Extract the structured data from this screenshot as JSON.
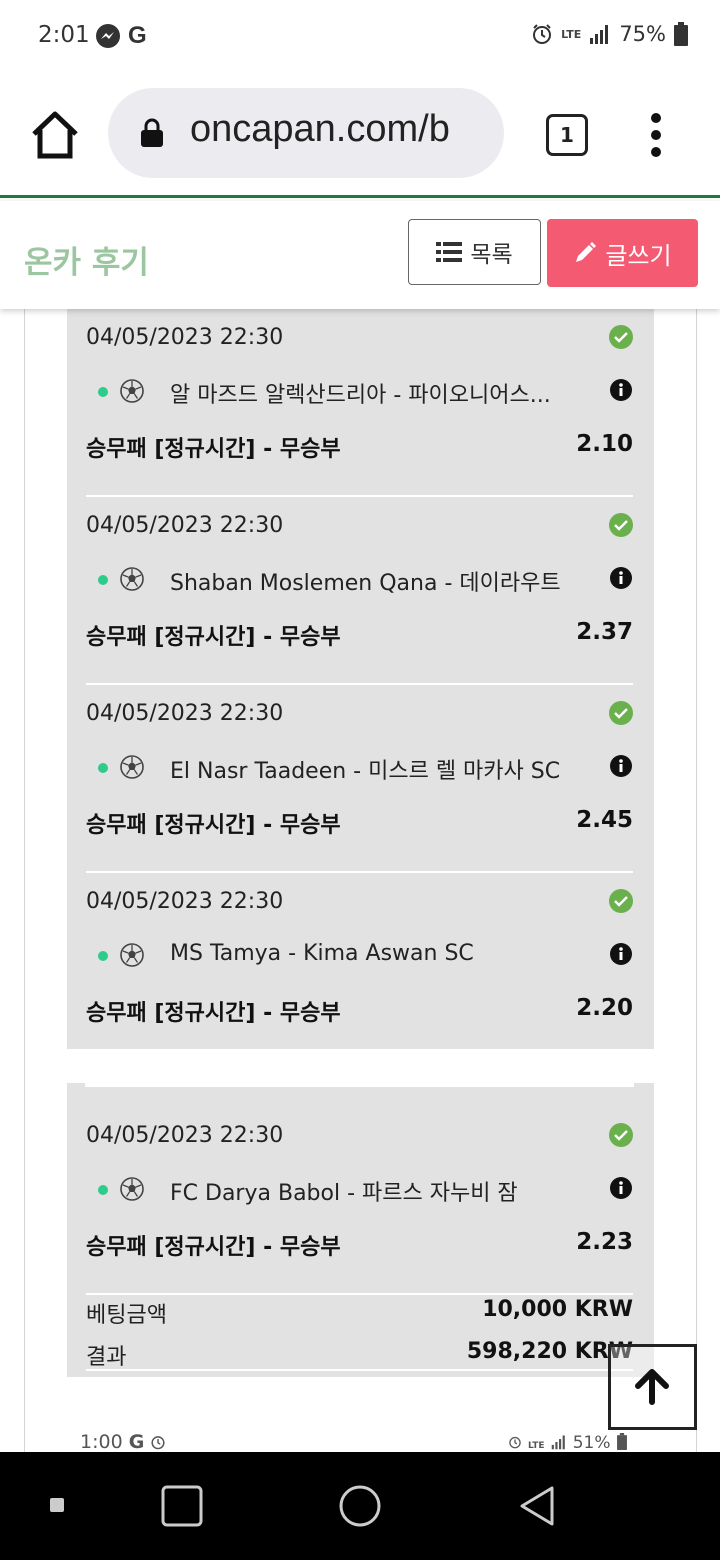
{
  "status_bar": {
    "time": "2:01",
    "carrier_glyph": "G",
    "network": "LTE",
    "battery": "75%",
    "icons": [
      "messenger-icon",
      "google-icon",
      "alarm-icon",
      "signal-icon",
      "battery-icon"
    ]
  },
  "browser": {
    "url": "oncapan.com/b",
    "tab_count": "1",
    "icons": [
      "home-icon",
      "lock-icon",
      "tabs-icon",
      "overflow-menu-icon"
    ]
  },
  "header": {
    "title": "온카 후기",
    "list_button": "목록",
    "write_button": "글쓰기",
    "colors": {
      "title": "#9cc6a0",
      "write_bg": "#f45b72"
    }
  },
  "bets": [
    {
      "date": "04/05/2023 22:30",
      "match": "알 마즈드 알렉산드리아 - 파이오니어스...",
      "market": "승무패 [정규시간] - 무승부",
      "odds": "2.10"
    },
    {
      "date": "04/05/2023 22:30",
      "match": "Shaban Moslemen Qana - 데이라우트",
      "market": "승무패 [정규시간] - 무승부",
      "odds": "2.37"
    },
    {
      "date": "04/05/2023 22:30",
      "match": "El Nasr Taadeen - 미스르 렐 마카사 SC",
      "market": "승무패 [정규시간] - 무승부",
      "odds": "2.45"
    },
    {
      "date": "04/05/2023 22:30",
      "match": "MS Tamya - Kima Aswan SC",
      "market": "승무패 [정규시간] - 무승부",
      "odds": "2.20"
    },
    {
      "date": "04/05/2023 22:30",
      "match": "FC Darya Babol - 파르스 자누비 잠",
      "market": "승무패 [정규시간] - 무승부",
      "odds": "2.23"
    }
  ],
  "summary": {
    "stake_label": "베팅금액",
    "stake_value": "10,000 KRW",
    "result_label": "결과",
    "result_value": "598,220 KRW"
  },
  "embedded_status": {
    "time": "1:00",
    "carrier_glyph": "G",
    "network": "LTE",
    "battery": "51%"
  },
  "status_colors": {
    "check": "#6ab04c",
    "dot": "#2ecc8a"
  }
}
